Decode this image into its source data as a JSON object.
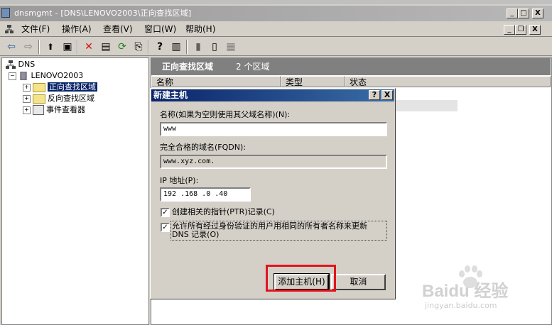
{
  "window": {
    "title": "dnsmgmt - [DNS\\LENOVO2003\\正向查找区域]",
    "min_btn": "_",
    "max_btn": "□",
    "close_btn": "X",
    "inner_min": "_",
    "inner_restore": "❐",
    "inner_close": "X"
  },
  "menu": [
    {
      "label": "文件(F)"
    },
    {
      "label": "操作(A)"
    },
    {
      "label": "查看(V)"
    },
    {
      "label": "窗口(W)"
    },
    {
      "label": "帮助(H)"
    }
  ],
  "toolbar": {
    "back": "⇦",
    "forward": "⇨",
    "up": "⬆",
    "showhide": "▣",
    "delete": "✕",
    "properties": "▤",
    "refresh": "⟳",
    "export": "⎘",
    "help": "?",
    "console": "▥",
    "t1": "▮",
    "t2": "▯",
    "t3": "▦"
  },
  "tree": {
    "root": "DNS",
    "server": "LENOVO2003",
    "items": [
      {
        "label": "正向查找区域"
      },
      {
        "label": "反向查找区域"
      },
      {
        "label": "事件查看器"
      }
    ]
  },
  "rightpane": {
    "header_title": "正向查找区域",
    "header_count": "2 个区域",
    "columns": [
      "名称",
      "类型",
      "状态"
    ]
  },
  "dialog": {
    "title": "新建主机",
    "help_btn": "?",
    "close_btn": "X",
    "name_label": "名称(如果为空则使用其父域名称)(N):",
    "name_value": "www",
    "fqdn_label": "完全合格的域名(FQDN):",
    "fqdn_value": "www.xyz.com.",
    "ip_label": "IP 地址(P):",
    "ip_value": "192 .168 .0   .40",
    "check1_label": "创建相关的指针(PTR)记录(C)",
    "check2_label_line1": "允许所有经过身份验证的用户用相同的所有者名称来更新",
    "check2_label_line2": "DNS 记录(O)",
    "check_mark": "✓",
    "add_button": "添加主机(H)",
    "cancel_button": "取消"
  },
  "watermark": {
    "text": "Baidu 经验",
    "url": "jingyan.baidu.com"
  },
  "colors": {
    "accent_red": "#e0141e",
    "title_blue": "#0a246a"
  }
}
